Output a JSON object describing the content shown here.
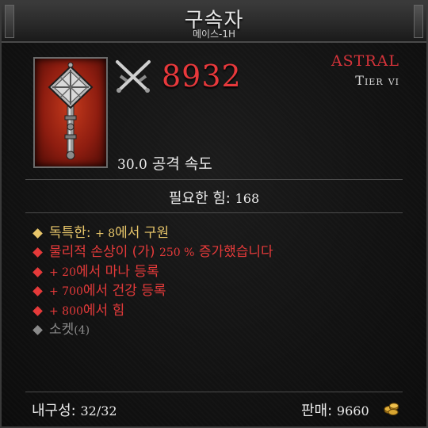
{
  "header": {
    "title": "구속자",
    "subtitle": "메이스-1H"
  },
  "item": {
    "icon": "mace-icon",
    "damage_icon": "crossed-swords-icon",
    "damage": "8932",
    "rarity": "ASTRAL",
    "tier": "Tier vi",
    "attack_speed_value": "30.0",
    "attack_speed_label": "공격 속도",
    "requirement_label": "필요한 힘:",
    "requirement_value": "168"
  },
  "affixes": [
    {
      "color": "#e8c66a",
      "prefix": "독특한: ",
      "value": "+ 8",
      "suffix": "에서 구원"
    },
    {
      "color": "#e53a3a",
      "prefix": "물리적 손상이 (가) ",
      "value": "250 %",
      "suffix": " 증가했습니다"
    },
    {
      "color": "#e53a3a",
      "prefix": "",
      "value": "+ 20",
      "suffix": "에서 마나 등록"
    },
    {
      "color": "#e53a3a",
      "prefix": "",
      "value": "+ 700",
      "suffix": "에서 건강 등록"
    },
    {
      "color": "#e53a3a",
      "prefix": "",
      "value": "+ 800",
      "suffix": "에서 힘"
    },
    {
      "color": "#8a8a8a",
      "prefix": "소켓",
      "value": "(4)",
      "suffix": ""
    }
  ],
  "footer": {
    "durability_label": "내구성:",
    "durability_value": "32/32",
    "sell_label": "판매:",
    "sell_value": "9660",
    "gold_icon": "gold-coins-icon"
  },
  "colors": {
    "damage": "#e8393c",
    "rarity": "#d5333a",
    "unique": "#e8c66a",
    "magic_affix": "#e53a3a",
    "socket": "#8a8a8a"
  }
}
